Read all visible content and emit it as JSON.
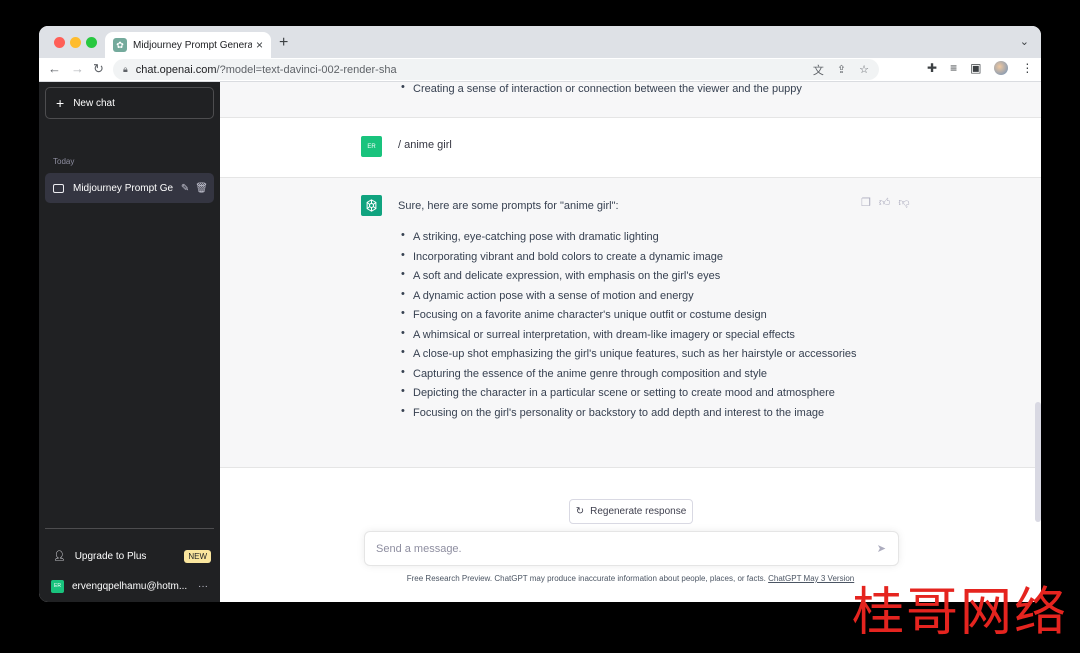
{
  "browser": {
    "tab_title": "Midjourney Prompt Generator.",
    "tab_close": "×",
    "new_tab": "+",
    "tab_menu": "⌄",
    "url_host": "chat.openai.com",
    "url_path": "/?model=text-davinci-002-render-sha"
  },
  "sidebar": {
    "new_chat_label": "New chat",
    "section_today": "Today",
    "chat_item_label": "Midjourney Prompt Ge",
    "upgrade_label": "Upgrade to Plus",
    "upgrade_badge": "NEW",
    "account_initials": "ER",
    "account_email": "ervengqpelhamu@hotm...",
    "account_more": "···"
  },
  "conversation": {
    "previous_tail": "Creating a sense of interaction or connection between the viewer and the puppy",
    "user_initials": "ER",
    "user_message": "/ anime girl",
    "assistant_intro": "Sure, here are some prompts for \"anime girl\":",
    "bullets": [
      "A striking, eye-catching pose with dramatic lighting",
      "Incorporating vibrant and bold colors to create a dynamic image",
      "A soft and delicate expression, with emphasis on the girl's eyes",
      "A dynamic action pose with a sense of motion and energy",
      "Focusing on a favorite anime character's unique outfit or costume design",
      "A whimsical or surreal interpretation, with dream-like imagery or special effects",
      "A close-up shot emphasizing the girl's unique features, such as her hairstyle or accessories",
      "Capturing the essence of the anime genre through composition and style",
      "Depicting the character in a particular scene or setting to create mood and atmosphere",
      "Focusing on the girl's personality or backstory to add depth and interest to the image"
    ]
  },
  "composer": {
    "regenerate_label": "Regenerate response",
    "placeholder": "Send a message.",
    "footer_text": "Free Research Preview. ChatGPT may produce inaccurate information about people, places, or facts. ",
    "footer_link": "ChatGPT May 3 Version"
  },
  "watermark": "桂哥网络",
  "colors": {
    "sidebar_bg": "#202123",
    "accent_green": "#10a37f",
    "user_avatar": "#19c37d",
    "badge": "#fae69e"
  }
}
